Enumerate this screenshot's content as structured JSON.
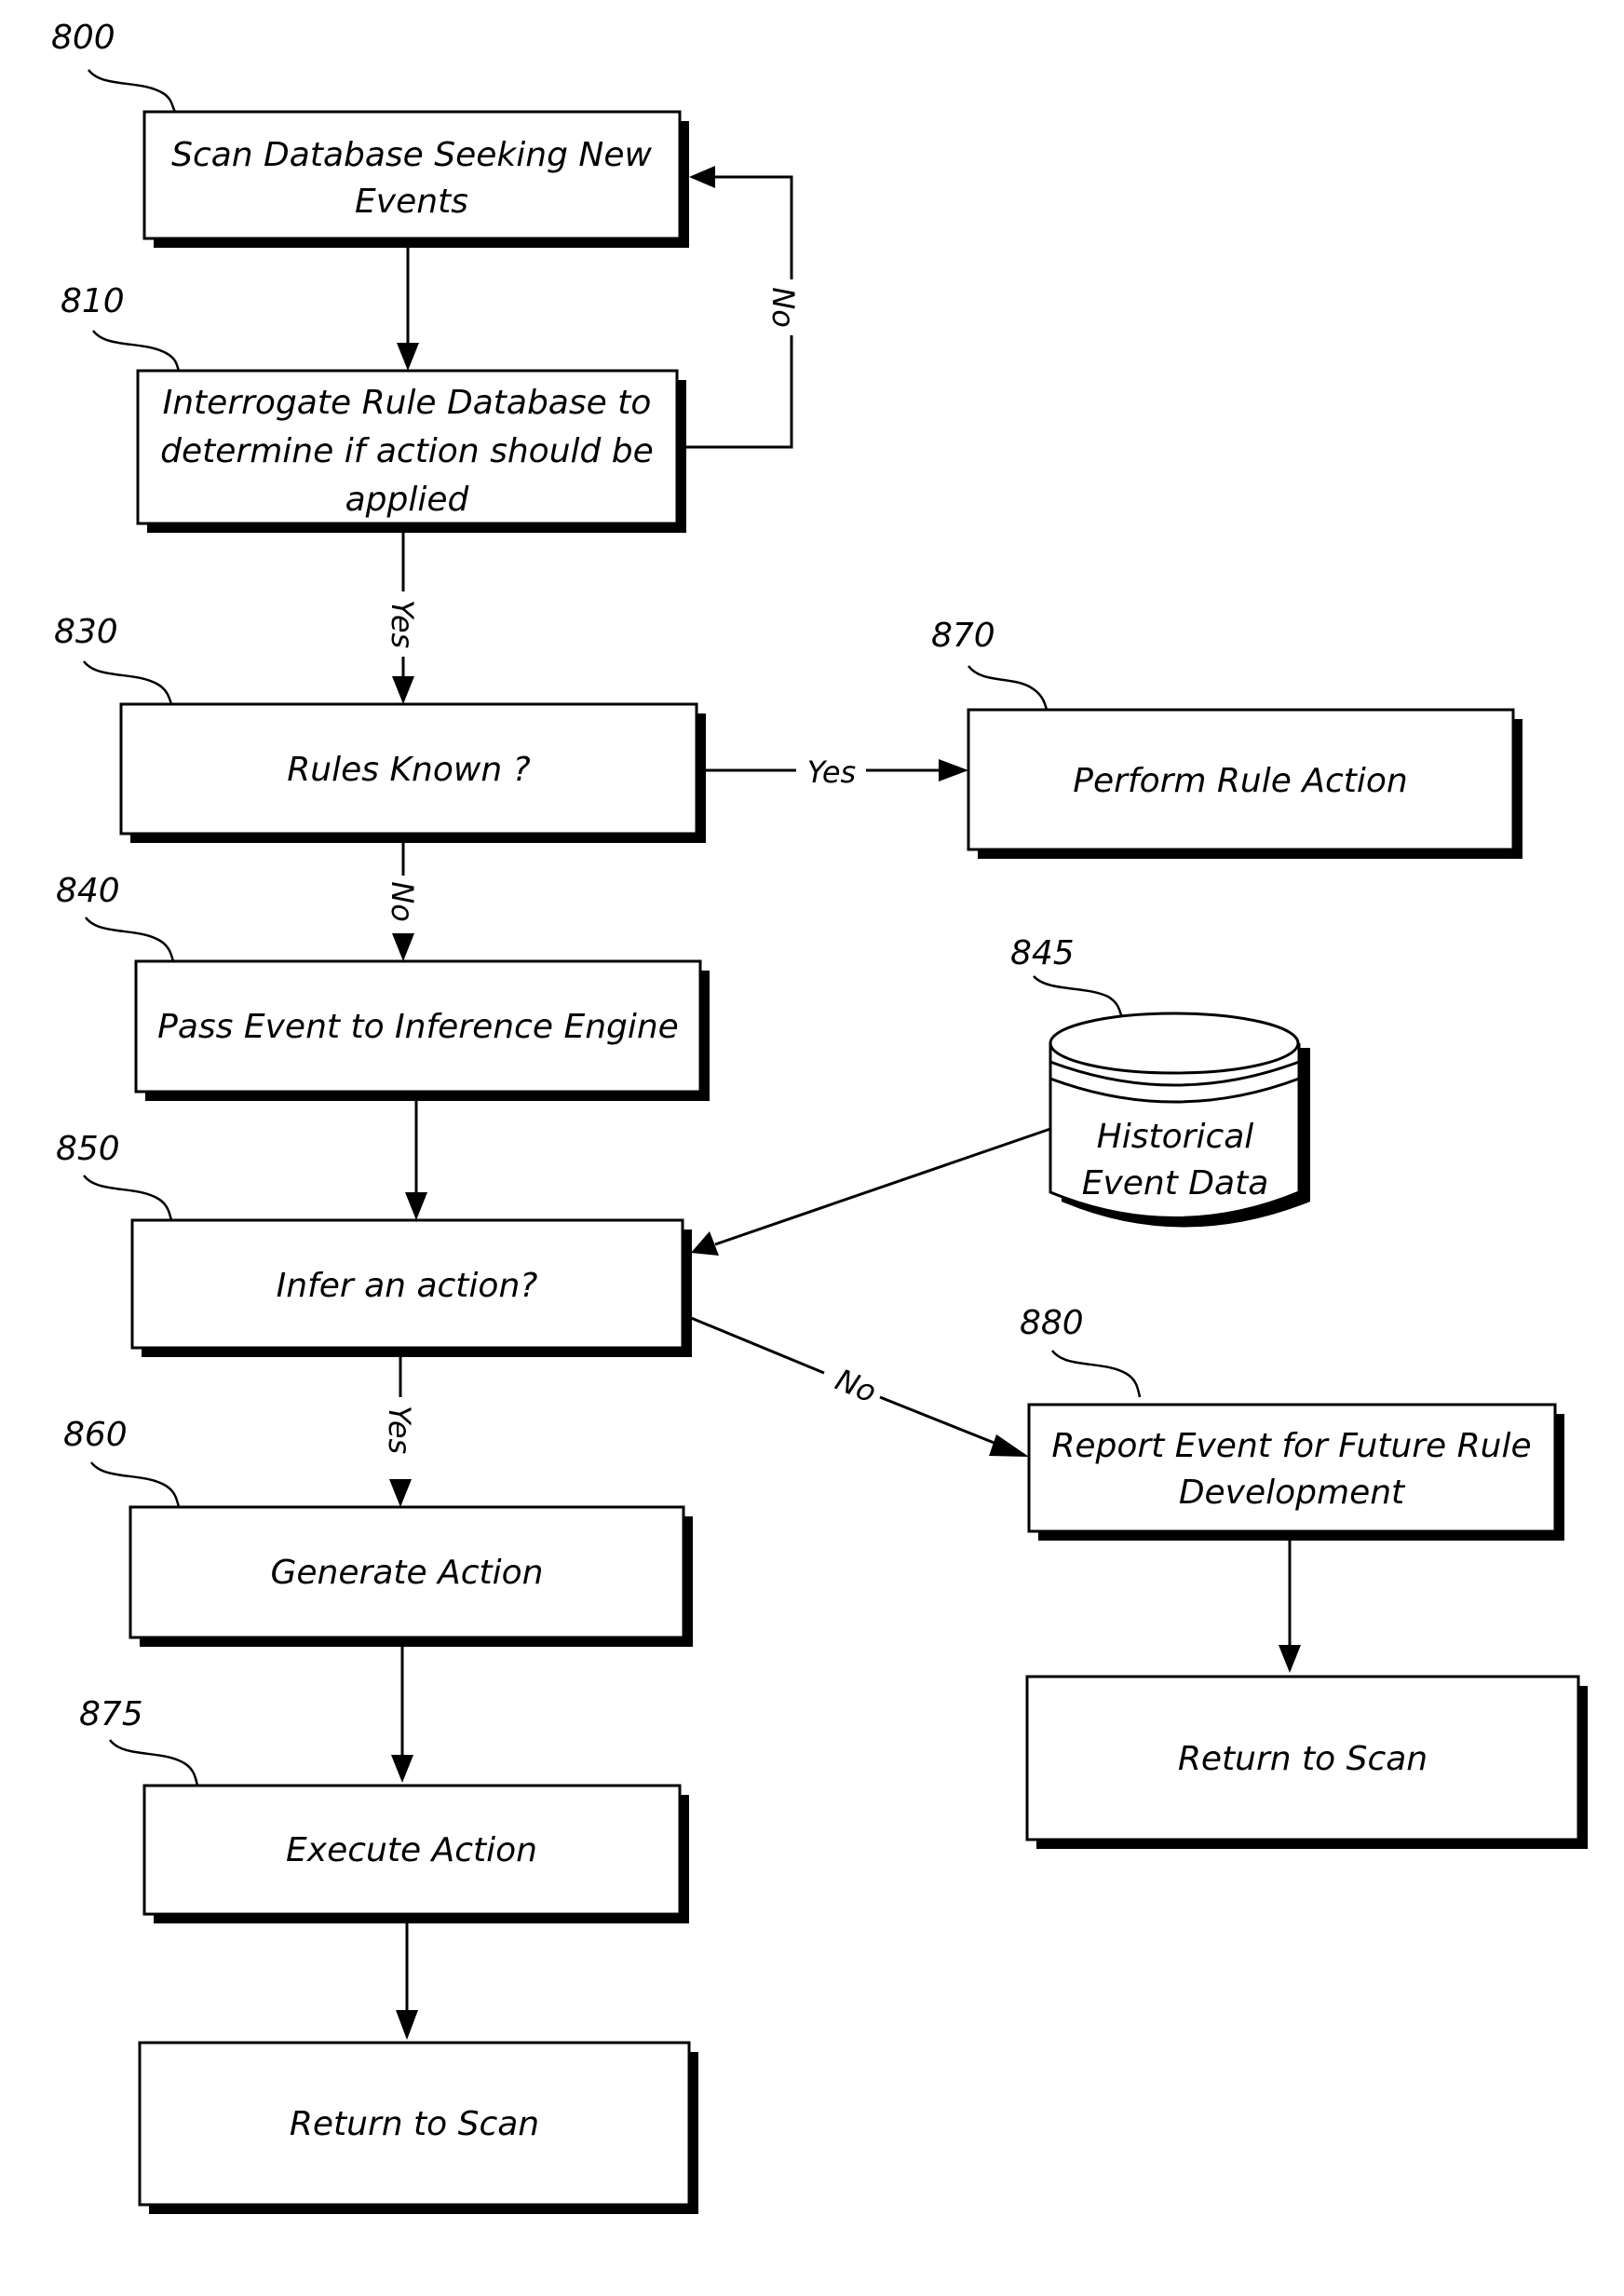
{
  "nodes": {
    "n800": {
      "ref": "800",
      "lines": [
        "Scan Database Seeking New",
        "Events"
      ]
    },
    "n810": {
      "ref": "810",
      "lines": [
        "Interrogate Rule Database to",
        "determine if action should be",
        "applied"
      ]
    },
    "n830": {
      "ref": "830",
      "lines": [
        "Rules Known ?"
      ]
    },
    "n870": {
      "ref": "870",
      "lines": [
        "Perform Rule Action"
      ]
    },
    "n840": {
      "ref": "840",
      "lines": [
        "Pass Event to Inference Engine"
      ]
    },
    "n845": {
      "ref": "845",
      "lines": [
        "Historical",
        "Event Data"
      ]
    },
    "n850": {
      "ref": "850",
      "lines": [
        "Infer an action?"
      ]
    },
    "n880": {
      "ref": "880",
      "lines": [
        "Report Event for Future Rule",
        "Development"
      ]
    },
    "n860": {
      "ref": "860",
      "lines": [
        "Generate Action"
      ]
    },
    "n875": {
      "ref": "875",
      "lines": [
        "Execute Action"
      ]
    },
    "return_right": {
      "lines": [
        "Return to Scan"
      ]
    },
    "return_left": {
      "lines": [
        "Return to Scan"
      ]
    }
  },
  "edges": {
    "e810_800_no": "No",
    "e810_830_yes": "Yes",
    "e830_870_yes": "Yes",
    "e830_840_no": "No",
    "e850_880_no": "No",
    "e850_860_yes": "Yes"
  }
}
